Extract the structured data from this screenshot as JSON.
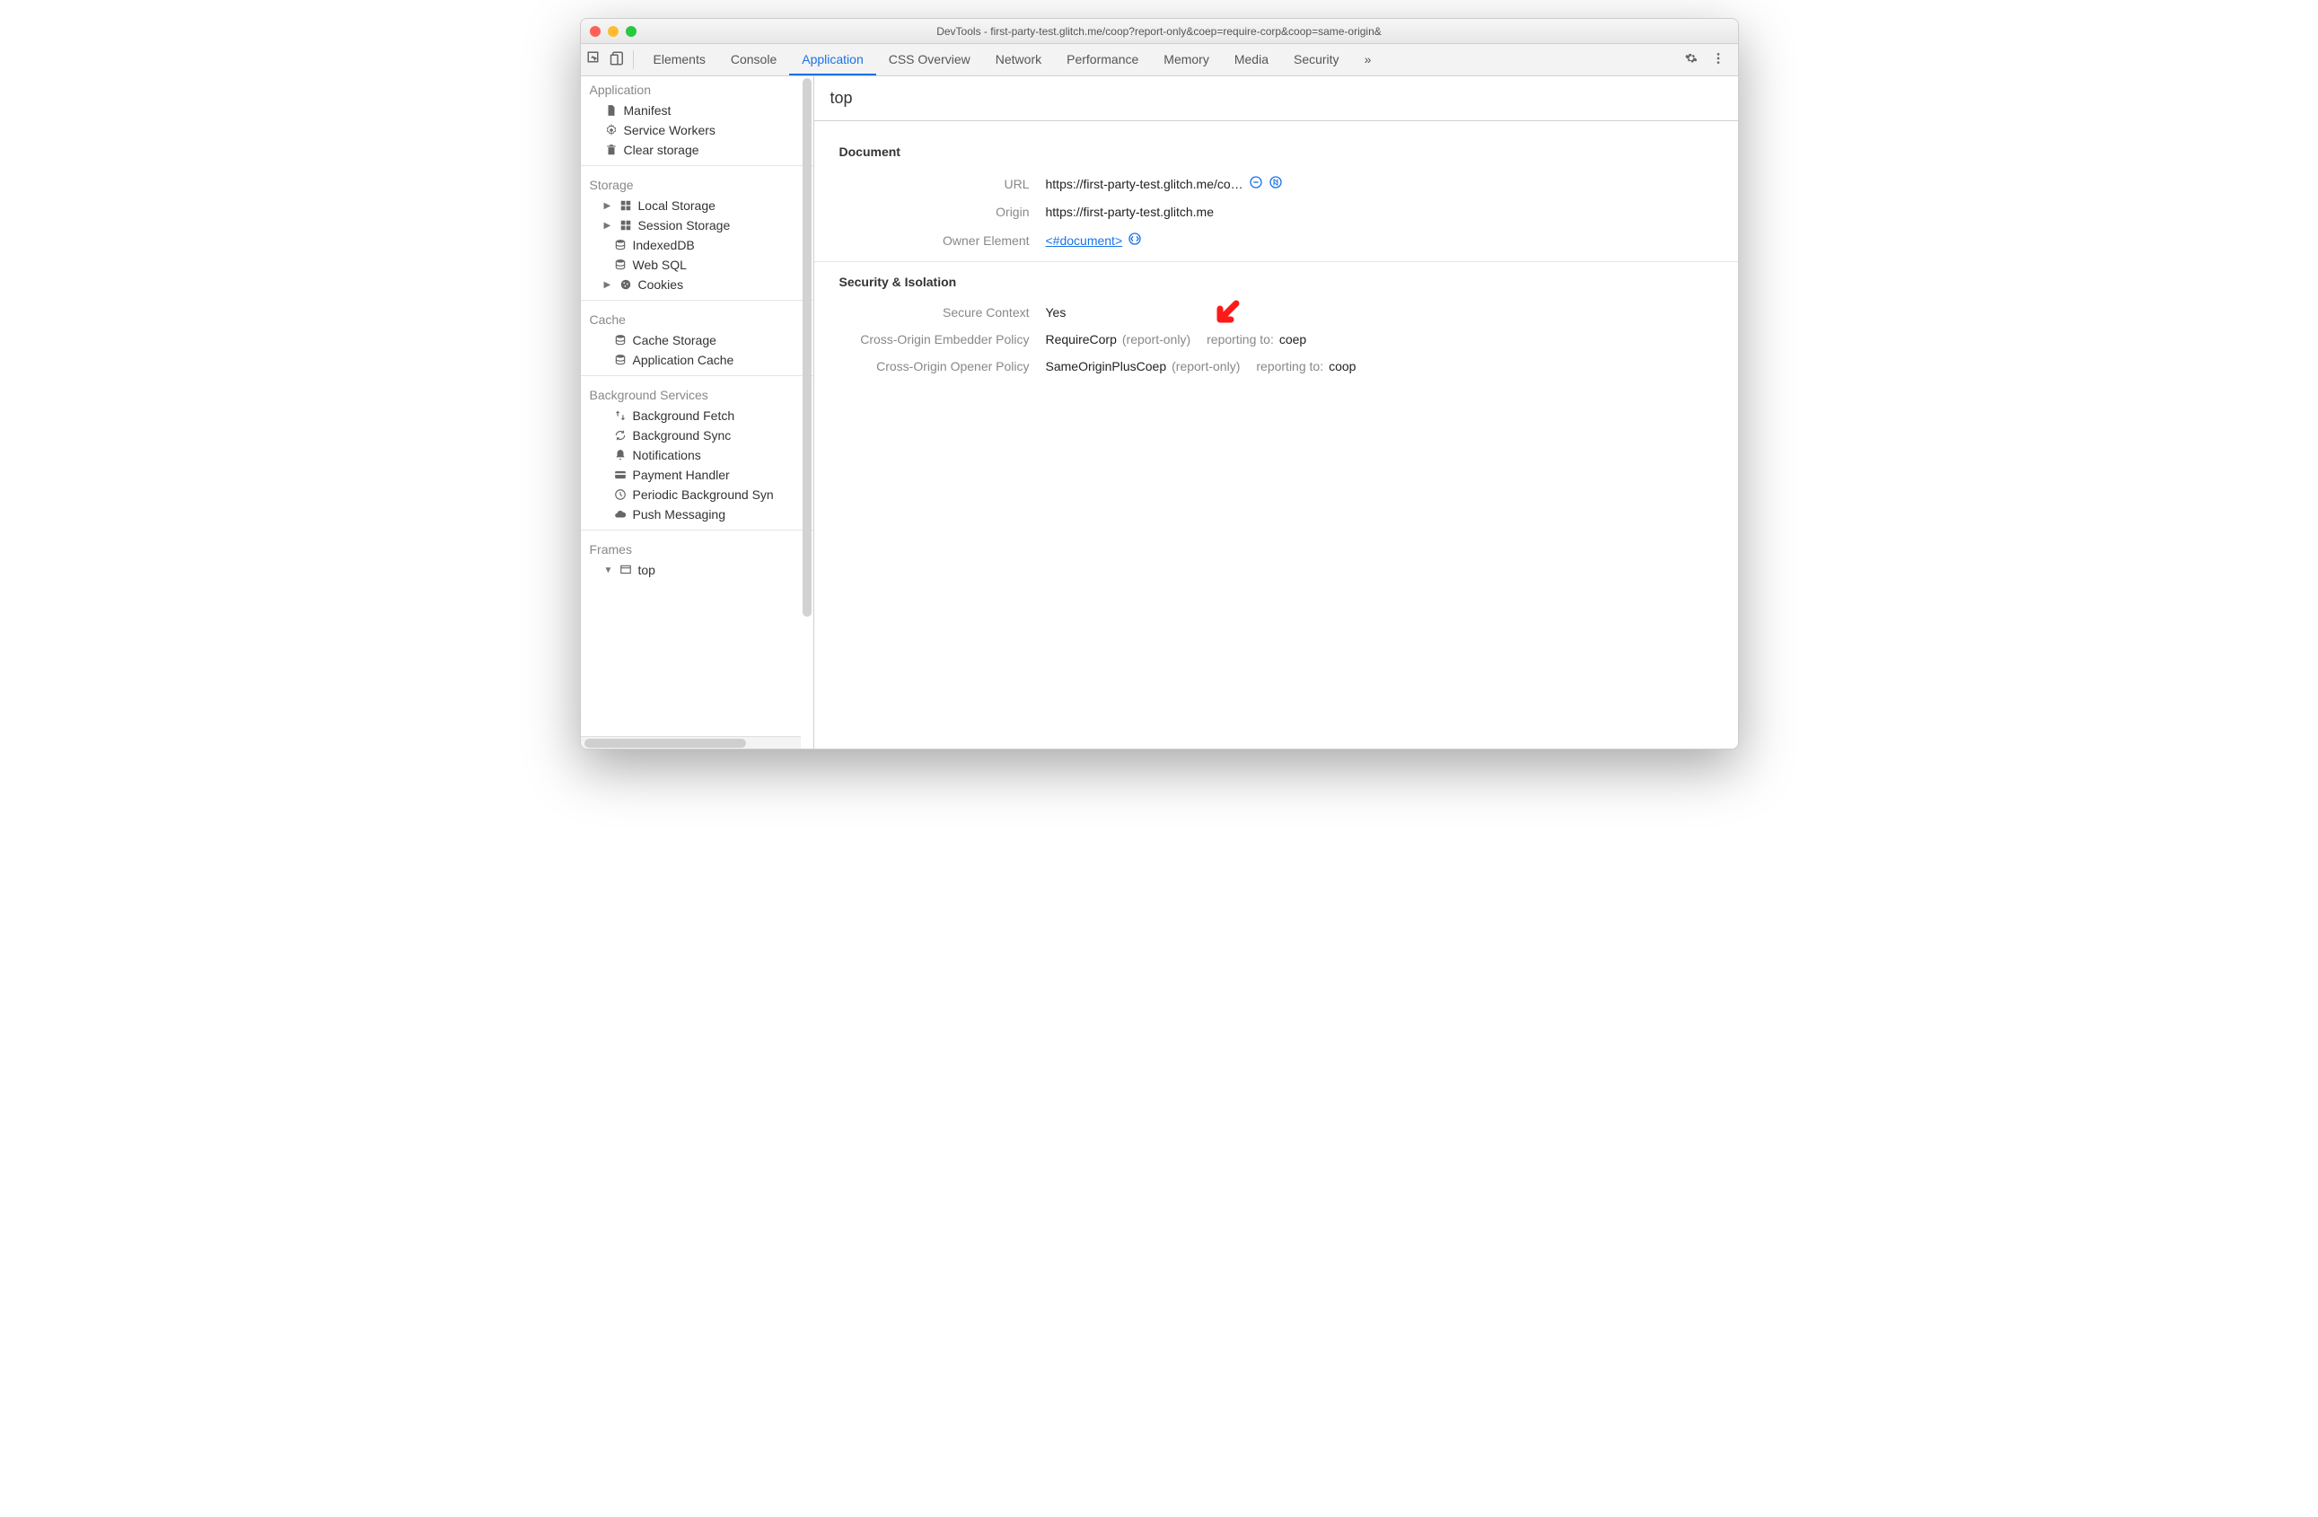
{
  "window": {
    "title": "DevTools - first-party-test.glitch.me/coop?report-only&coep=require-corp&coop=same-origin&"
  },
  "tabs": {
    "items": [
      "Elements",
      "Console",
      "Application",
      "CSS Overview",
      "Network",
      "Performance",
      "Memory",
      "Media",
      "Security"
    ],
    "active": "Application",
    "more": "»"
  },
  "sidebar": {
    "groups": [
      {
        "title": "Application",
        "items": [
          {
            "label": "Manifest",
            "icon": "file"
          },
          {
            "label": "Service Workers",
            "icon": "gear"
          },
          {
            "label": "Clear storage",
            "icon": "trash"
          }
        ]
      },
      {
        "title": "Storage",
        "items": [
          {
            "label": "Local Storage",
            "icon": "grid",
            "expander": "▶"
          },
          {
            "label": "Session Storage",
            "icon": "grid",
            "expander": "▶"
          },
          {
            "label": "IndexedDB",
            "icon": "db"
          },
          {
            "label": "Web SQL",
            "icon": "db"
          },
          {
            "label": "Cookies",
            "icon": "cookie",
            "expander": "▶"
          }
        ]
      },
      {
        "title": "Cache",
        "items": [
          {
            "label": "Cache Storage",
            "icon": "db"
          },
          {
            "label": "Application Cache",
            "icon": "db"
          }
        ]
      },
      {
        "title": "Background Services",
        "items": [
          {
            "label": "Background Fetch",
            "icon": "updown"
          },
          {
            "label": "Background Sync",
            "icon": "sync"
          },
          {
            "label": "Notifications",
            "icon": "bell"
          },
          {
            "label": "Payment Handler",
            "icon": "card"
          },
          {
            "label": "Periodic Background Syn",
            "icon": "clock"
          },
          {
            "label": "Push Messaging",
            "icon": "cloud"
          }
        ]
      },
      {
        "title": "Frames",
        "items": [
          {
            "label": "top",
            "icon": "window",
            "expander": "▼"
          }
        ]
      }
    ]
  },
  "main": {
    "header": "top",
    "document": {
      "title": "Document",
      "url_label": "URL",
      "url_value": "https://first-party-test.glitch.me/co…",
      "origin_label": "Origin",
      "origin_value": "https://first-party-test.glitch.me",
      "owner_label": "Owner Element",
      "owner_value": "<#document>"
    },
    "security": {
      "title": "Security & Isolation",
      "secure_label": "Secure Context",
      "secure_value": "Yes",
      "coep_label": "Cross-Origin Embedder Policy",
      "coep_value": "RequireCorp",
      "coep_report": "(report-only)",
      "coep_reporting": "reporting to:",
      "coep_endpoint": "coep",
      "coop_label": "Cross-Origin Opener Policy",
      "coop_value": "SameOriginPlusCoep",
      "coop_report": "(report-only)",
      "coop_reporting": "reporting to:",
      "coop_endpoint": "coop"
    }
  }
}
